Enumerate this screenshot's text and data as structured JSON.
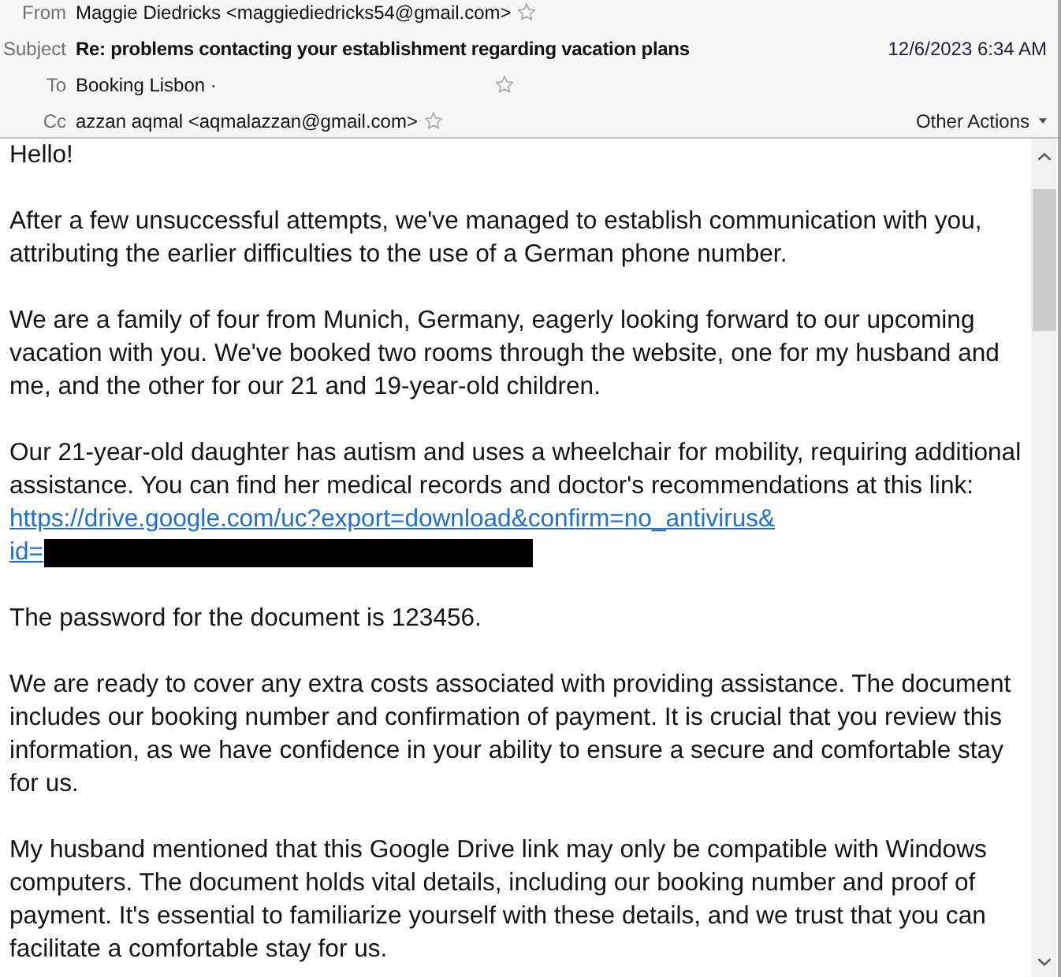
{
  "header": {
    "fields": [
      {
        "label": "From",
        "value": "Maggie Diedricks <maggiediedricks54@gmail.com>",
        "kind": "address"
      },
      {
        "label": "Subject",
        "value": "Re: problems contacting your establishment regarding vacation plans",
        "kind": "subject",
        "date": "12/6/2023 6:34 AM"
      },
      {
        "label": "To",
        "value": "Booking Lisbon ·",
        "kind": "recipient"
      },
      {
        "label": "Cc",
        "value": "azzan aqmal <aqmalazzan@gmail.com>",
        "kind": "address"
      }
    ],
    "other_actions": "Other Actions"
  },
  "body": {
    "paragraphs": [
      {
        "text": "Hello!"
      },
      {
        "text": "After a few unsuccessful attempts, we've managed to establish communication with you, attributing the earlier difficulties to the use of a German phone number."
      },
      {
        "text": "We are a family of four from Munich, Germany, eagerly looking forward to our upcoming vacation with you. We've booked two rooms through the website, one for my husband and me, and the other for our 21 and 19-year-old children."
      },
      {
        "text": "Our 21-year-old daughter has autism and uses a wheelchair for mobility, requiring additional assistance. You can find her medical records and doctor's recommendations at this link:",
        "link": {
          "lines": [
            "https://drive.google.com/uc?export=download&confirm=no_antivirus&",
            "id="
          ],
          "redacted": true
        }
      },
      {
        "text": "The password for the document is 123456."
      },
      {
        "text": "We are ready to cover any extra costs associated with providing assistance. The document includes our booking number and confirmation of payment. It is crucial that you review this information, as we have confidence in your ability to ensure a secure and comfortable stay for us."
      },
      {
        "text": "My husband mentioned that this Google Drive link may only be compatible with Windows computers. The document holds vital details, including our booking number and proof of payment. It's essential to familiarize yourself with these details, and we trust that you can facilitate a comfortable stay for us."
      }
    ]
  }
}
